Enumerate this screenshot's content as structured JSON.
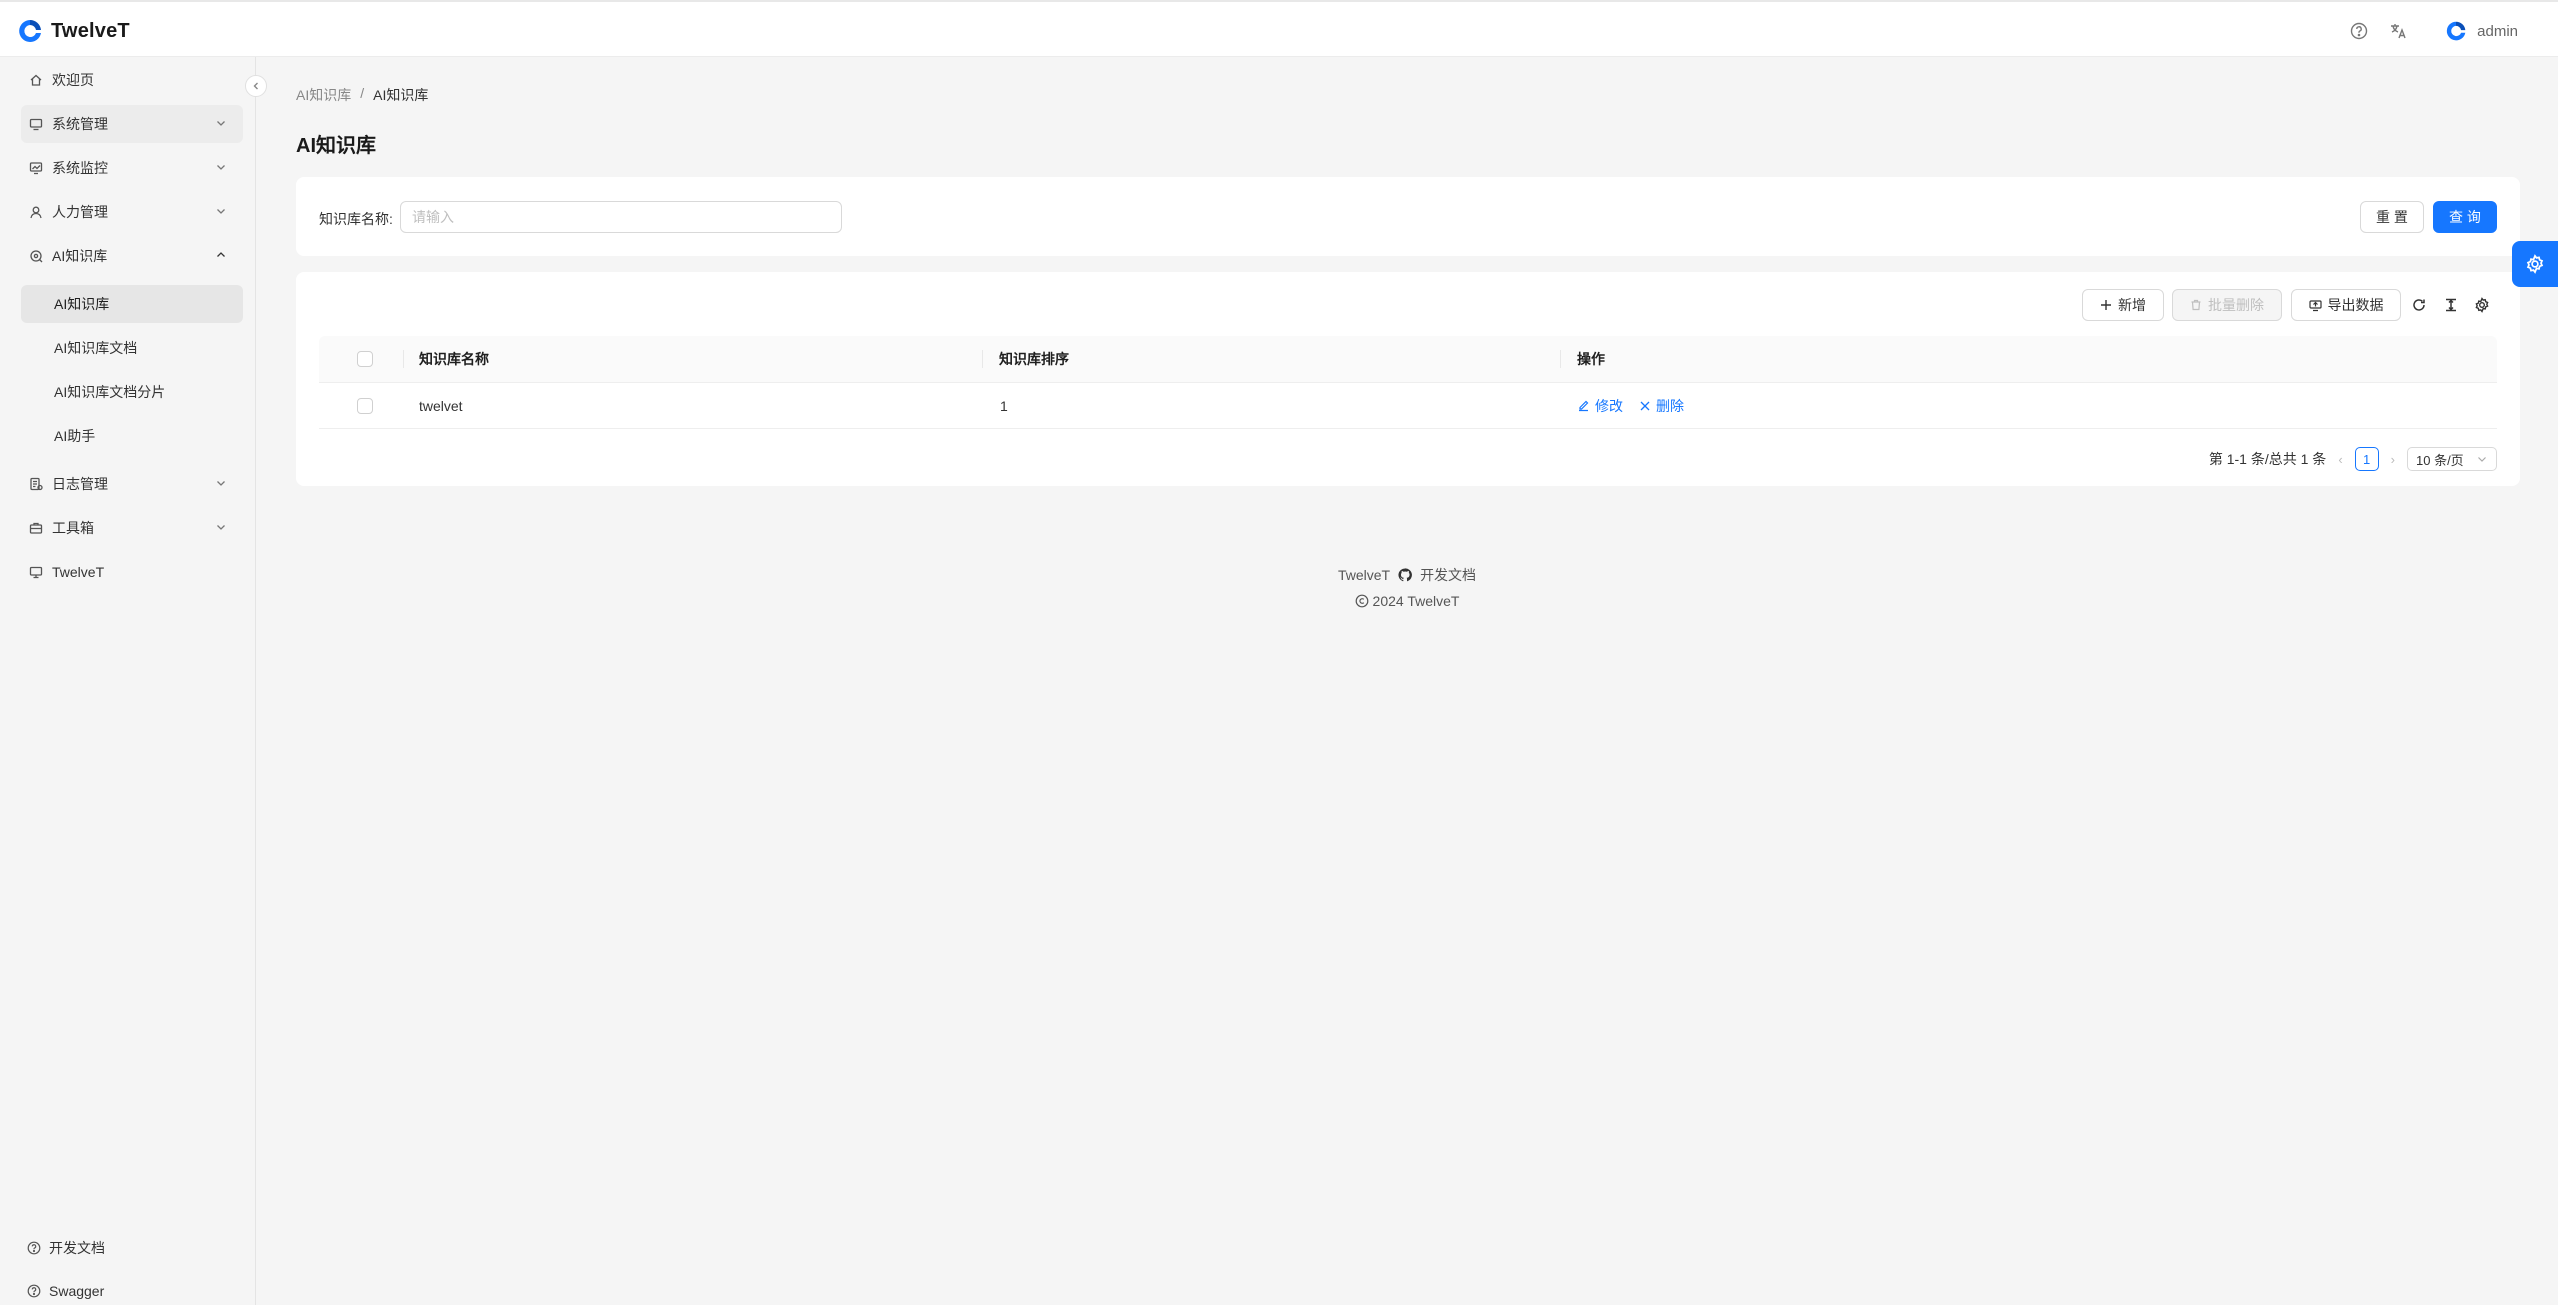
{
  "app": {
    "name": "TwelveT",
    "user": "admin"
  },
  "header": {
    "help_icon": "question-circle-icon",
    "lang_icon": "translate-icon"
  },
  "sidebar": {
    "items": [
      {
        "label": "欢迎页",
        "icon": "home-icon",
        "expandable": false
      },
      {
        "label": "系统管理",
        "icon": "monitor-icon",
        "expandable": true
      },
      {
        "label": "系统监控",
        "icon": "fund-icon",
        "expandable": true
      },
      {
        "label": "人力管理",
        "icon": "user-icon",
        "expandable": true
      },
      {
        "label": "AI知识库",
        "icon": "knowledge-icon",
        "expandable": true,
        "expanded": true
      },
      {
        "label": "日志管理",
        "icon": "log-icon",
        "expandable": true
      },
      {
        "label": "工具箱",
        "icon": "toolbox-icon",
        "expandable": true
      },
      {
        "label": "TwelveT",
        "icon": "desktop-icon",
        "expandable": false
      }
    ],
    "sub_items": [
      {
        "label": "AI知识库",
        "active": true
      },
      {
        "label": "AI知识库文档",
        "active": false
      },
      {
        "label": "AI知识库文档分片",
        "active": false
      },
      {
        "label": "AI助手",
        "active": false
      }
    ],
    "bottom": [
      {
        "label": "开发文档",
        "icon": "question-circle-icon"
      },
      {
        "label": "Swagger",
        "icon": "question-circle-icon"
      }
    ]
  },
  "breadcrumb": {
    "parent": "AI知识库",
    "separator": "/",
    "current": "AI知识库"
  },
  "page_title": "AI知识库",
  "search": {
    "label": "知识库名称:",
    "placeholder": "请输入",
    "value": "",
    "reset_label": "重 置",
    "query_label": "查 询"
  },
  "toolbar": {
    "add_label": "新增",
    "batch_delete_label": "批量删除",
    "export_label": "导出数据"
  },
  "table": {
    "columns": [
      "知识库名称",
      "知识库排序",
      "操作"
    ],
    "rows": [
      {
        "name": "twelvet",
        "sort": "1",
        "edit": "修改",
        "delete": "删除"
      }
    ]
  },
  "pagination": {
    "summary": "第 1-1 条/总共 1 条",
    "current_page": "1",
    "page_size": "10 条/页"
  },
  "footer": {
    "brand": "TwelveT",
    "docs": "开发文档",
    "copyright": "2024 TwelveT"
  },
  "colors": {
    "primary": "#1677ff",
    "background": "#f5f5f5"
  }
}
